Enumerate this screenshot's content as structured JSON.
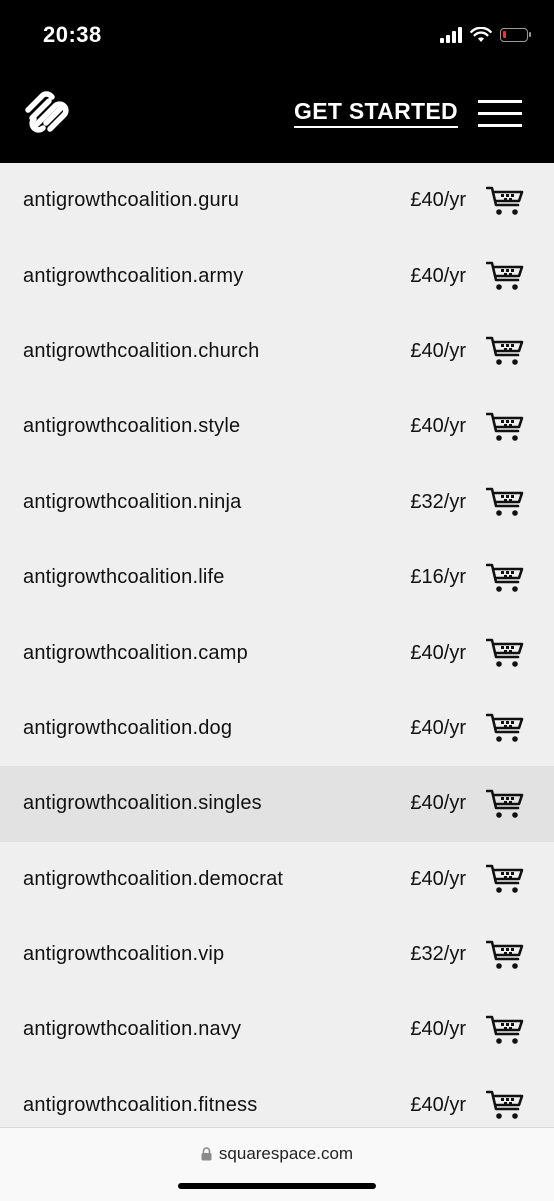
{
  "status_bar": {
    "time": "20:38"
  },
  "nav": {
    "logo_icon": "squarespace-logo",
    "cta_label": "GET STARTED",
    "menu_icon": "hamburger-menu-icon"
  },
  "domains": [
    {
      "name": "antigrowthcoalition.guru",
      "price": "£40/yr"
    },
    {
      "name": "antigrowthcoalition.army",
      "price": "£40/yr"
    },
    {
      "name": "antigrowthcoalition.church",
      "price": "£40/yr"
    },
    {
      "name": "antigrowthcoalition.style",
      "price": "£40/yr"
    },
    {
      "name": "antigrowthcoalition.ninja",
      "price": "£32/yr"
    },
    {
      "name": "antigrowthcoalition.life",
      "price": "£16/yr"
    },
    {
      "name": "antigrowthcoalition.camp",
      "price": "£40/yr"
    },
    {
      "name": "antigrowthcoalition.dog",
      "price": "£40/yr"
    },
    {
      "name": "antigrowthcoalition.singles",
      "price": "£40/yr"
    },
    {
      "name": "antigrowthcoalition.democrat",
      "price": "£40/yr"
    },
    {
      "name": "antigrowthcoalition.vip",
      "price": "£32/yr"
    },
    {
      "name": "antigrowthcoalition.navy",
      "price": "£40/yr"
    },
    {
      "name": "antigrowthcoalition.fitness",
      "price": "£40/yr"
    }
  ],
  "highlighted_row": "antigrowthcoalition.singles",
  "cart_icon": "add-to-cart-icon",
  "browser": {
    "url": "squarespace.com"
  },
  "colors": {
    "header_bg": "#000000",
    "list_bg": "#efefef",
    "highlight_bg": "#e2e2e2"
  }
}
